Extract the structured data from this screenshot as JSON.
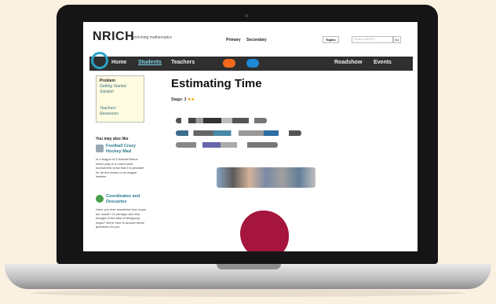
{
  "site": {
    "logo": "NRICH",
    "tagline": "enriching mathematics",
    "sections": [
      "Primary",
      "Secondary"
    ],
    "topics_label": "Topics",
    "search_placeholder": "Search NRICH",
    "go_label": "Go"
  },
  "nav": {
    "items": [
      "Home",
      "Students",
      "Teachers"
    ],
    "active": "Students",
    "right_items": [
      "Roadshow",
      "Events"
    ]
  },
  "sidebar": {
    "box_title": "Problem",
    "box_links": [
      "Getting Started",
      "Solution",
      "Teachers'",
      "Resources"
    ],
    "also_label": "You may also like",
    "related": [
      {
        "title": "Football Crazy Hockey Mad",
        "blurb": "In a league of 5 football teams which play in a round robin tournament show that it is possible for all five teams to be league leaders."
      },
      {
        "title": "Coordinates and Descartes",
        "blurb": "Have you ever wondered how maps are made? Or perhaps who first thought of the idea of designing maps? We're here to answer these questions for you."
      }
    ]
  },
  "content": {
    "title": "Estimating Time",
    "stage_label": "Stage: 3"
  },
  "colors": {
    "nav_bg": "#2f2f2f",
    "accent": "#28a4c8",
    "orange_pill": "#f26a1b",
    "blue_pill": "#1e88d8",
    "blob": "#a5153e"
  }
}
